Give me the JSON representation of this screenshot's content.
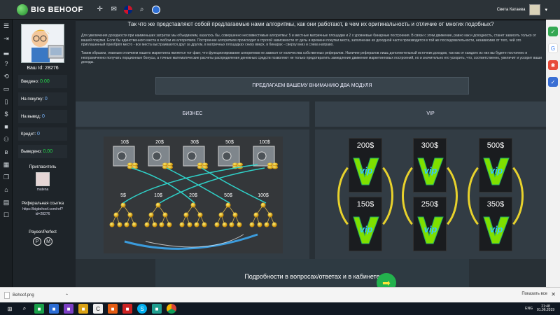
{
  "topbar": {
    "logo": "BIG BEHOOF",
    "user_name": "Света Катаева"
  },
  "profile": {
    "user_id": "Ваш Id: 28276",
    "stats": [
      {
        "label": "Введено:",
        "value": "0.00"
      },
      {
        "label": "На покупку:",
        "value": "0"
      },
      {
        "label": "На вывод:",
        "value": "0"
      },
      {
        "label": "Кредит:",
        "value": "0"
      },
      {
        "label": "Выведено:",
        "value": "0.00"
      }
    ],
    "referrer_label": "Пригласитель",
    "referrer_name": "matena",
    "reflink_label": "Реферальная ссылка",
    "reflink_value": "https://bigbehoof.com/ref?id=28276",
    "payment_label": "Payeer/Perfect"
  },
  "main": {
    "heading": "Так что же представляют собой предлагаемые нами алгоритмы, как они работают, в чем их оригинальность и отличие от многих подобных?",
    "para1": "Для увеличения доходности при наименьших затратах мы объединяем, казалось бы, совершенно несовместимые алгоритмы: 5 и местные матричные площадки и 2 х уровневые бинарные построения. В связи с этим движение, равно как и доходность, станет зависеть только от вашей покупки. Если бы единственного места в любом из алгоритмов. Построение алгоритмов происходит в строгой зависимости от даты и времени покупки места, заполнение их доходной части производится в той же последовательности, независимо от того, чей это приглашенный приобрёл место - все места выстраиваются друг за другом, в матричных площадках снизу вверх, в бинарах - сверху вниз и слева направо.",
    "para2": "Таким образом, главным отличием нашего маркетинга является тот факт, что функционирование алгоритмов не зависит от количества собственных рефералов. Наличие рефералов лишь дополнительный источник доходов, так как от каждого из них вы будете постоянно и неограниченно получать порционные бонусы, а точные математические расчеты распределения денежных средств позволяют не только предотвратить замедление движения маркетинговых построений, но и значительно его ускорить, что, соответственно, увеличит и ускорит ваши доходы.",
    "banner": "ПРЕДЛАГАЕМ ВАШЕМУ ВНИМАНИЮ ДВА МОДУЛЯ",
    "business_title": "БИЗНЕС",
    "vip_title": "VIP",
    "business_matrix_prices": [
      "10$",
      "20$",
      "30$",
      "50$",
      "100$"
    ],
    "business_binary_prices": [
      "5$",
      "10$",
      "20$",
      "50$",
      "100$"
    ],
    "vip_prices": [
      "200$",
      "300$",
      "500$",
      "150$",
      "250$",
      "350$"
    ],
    "vip_logo_text": "vip",
    "details_text": "Подробности в вопросах/ответах и в кабинете"
  },
  "downloads": {
    "file": "Behoof.png",
    "show_all": "Показать все"
  },
  "taskbar": {
    "lang": "ENG",
    "time": "21:48",
    "date": "01.06.2019"
  }
}
